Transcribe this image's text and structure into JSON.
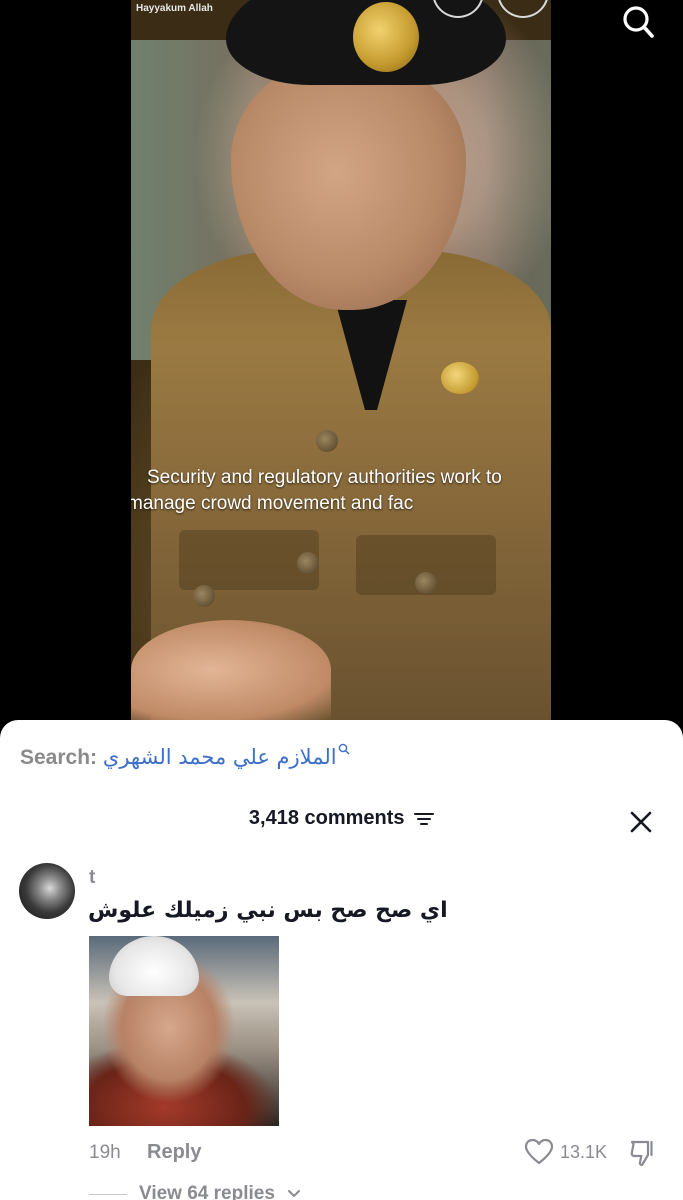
{
  "video": {
    "channel_name": "Hayyakum Allah",
    "caption_line1": "Security and regulatory authorities work to",
    "caption_line2": "manage crowd movement and fac"
  },
  "top_bar": {
    "search_icon": "search-icon"
  },
  "comments_panel": {
    "search_label": "Search:",
    "search_query": "الملازم علي محمد الشهري",
    "comment_count_label": "3,418 comments",
    "filter_icon": "filter-icon",
    "close_icon": "close-icon"
  },
  "comment": {
    "username": "t",
    "text": "اي صح صح بس نبي زميلك علوش",
    "time": "19h",
    "reply_label": "Reply",
    "like_count": "13.1K",
    "view_replies_label": "View 64 replies"
  },
  "colors": {
    "accent_link": "#3d6ec9",
    "muted_text": "#8a8b91",
    "primary_text": "#161823"
  }
}
